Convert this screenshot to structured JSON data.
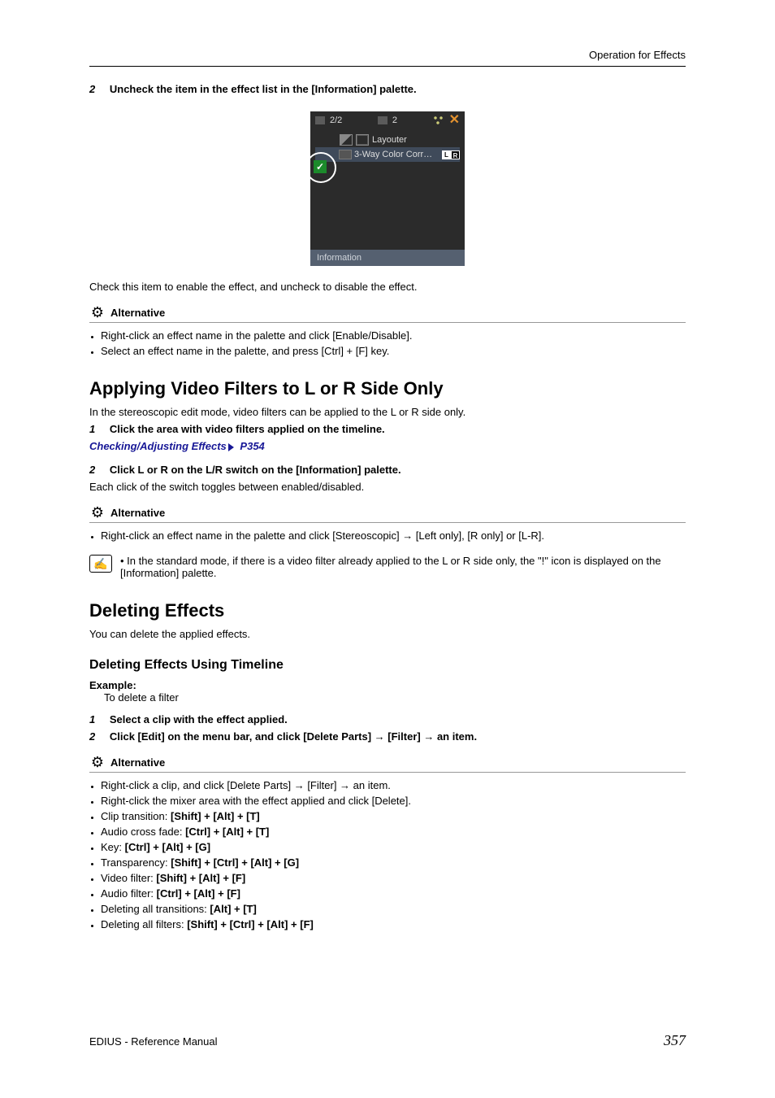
{
  "header": {
    "section": "Operation for Effects"
  },
  "step2a": {
    "num": "2",
    "text": "Uncheck the item in the effect list in the [Information] palette."
  },
  "panel": {
    "top_left": "2/2",
    "top_mid": "2",
    "row1": "Layouter",
    "row2": "3-Way Color Corr…",
    "lr_l": "L",
    "lr_r": "R",
    "footer": "Information"
  },
  "afterPanel": "Check this item to enable the effect, and uncheck to disable the effect.",
  "altLabel": "Alternative",
  "alt1": {
    "i1": "Right-click an effect name in the palette and click [Enable/Disable].",
    "i2": "Select an effect name in the palette, and press [Ctrl] + [F] key."
  },
  "sectionA": {
    "title": "Applying Video Filters to L or R Side Only",
    "intro": "In the stereoscopic edit mode, video filters can be applied to the L or R side only.",
    "s1num": "1",
    "s1text": "Click the area with video filters applied on the timeline.",
    "link_text": "Checking/Adjusting Effects",
    "link_page": "P354",
    "s2num": "2",
    "s2text": "Click L or R on the L/R switch on the [Information] palette.",
    "s2sub": "Each click of the switch toggles between enabled/disabled."
  },
  "alt2": {
    "i1_a": "Right-click an effect name in the palette and click [Stereoscopic] ",
    "i1_b": " [Left only], [R only] or [L-R]."
  },
  "note1": "In the standard mode, if there is a video filter already applied to the L or R side only, the \"!\" icon is displayed on the [Information] palette.",
  "sectionB": {
    "title": "Deleting Effects",
    "intro": "You can delete the applied effects.",
    "sub": "Deleting Effects Using Timeline",
    "exLabel": "Example:",
    "exText": "To delete a filter",
    "s1num": "1",
    "s1text": "Select a clip with the effect applied.",
    "s2num": "2",
    "s2a": "Click [Edit] on the menu bar, and click [Delete Parts] ",
    "s2b": " [Filter] ",
    "s2c": " an item."
  },
  "alt3": {
    "i1a": "Right-click a clip, and click [Delete Parts] ",
    "i1b": " [Filter] ",
    "i1c": " an item.",
    "i2": "Right-click the mixer area with the effect applied and click [Delete].",
    "i3l": "Clip transition: ",
    "i3k": "[Shift] + [Alt] + [T]",
    "i4l": "Audio cross fade: ",
    "i4k": "[Ctrl] + [Alt] + [T]",
    "i5l": "Key: ",
    "i5k": "[Ctrl] + [Alt] + [G]",
    "i6l": "Transparency: ",
    "i6k": "[Shift] + [Ctrl] + [Alt] + [G]",
    "i7l": "Video filter: ",
    "i7k": "[Shift] + [Alt] + [F]",
    "i8l": "Audio filter: ",
    "i8k": "[Ctrl] + [Alt] + [F]",
    "i9l": "Deleting all transitions: ",
    "i9k": "[Alt] + [T]",
    "i10l": "Deleting all filters: ",
    "i10k": "[Shift] + [Ctrl] + [Alt] + [F]"
  },
  "footer": {
    "left": "EDIUS - Reference Manual",
    "right": "357"
  }
}
